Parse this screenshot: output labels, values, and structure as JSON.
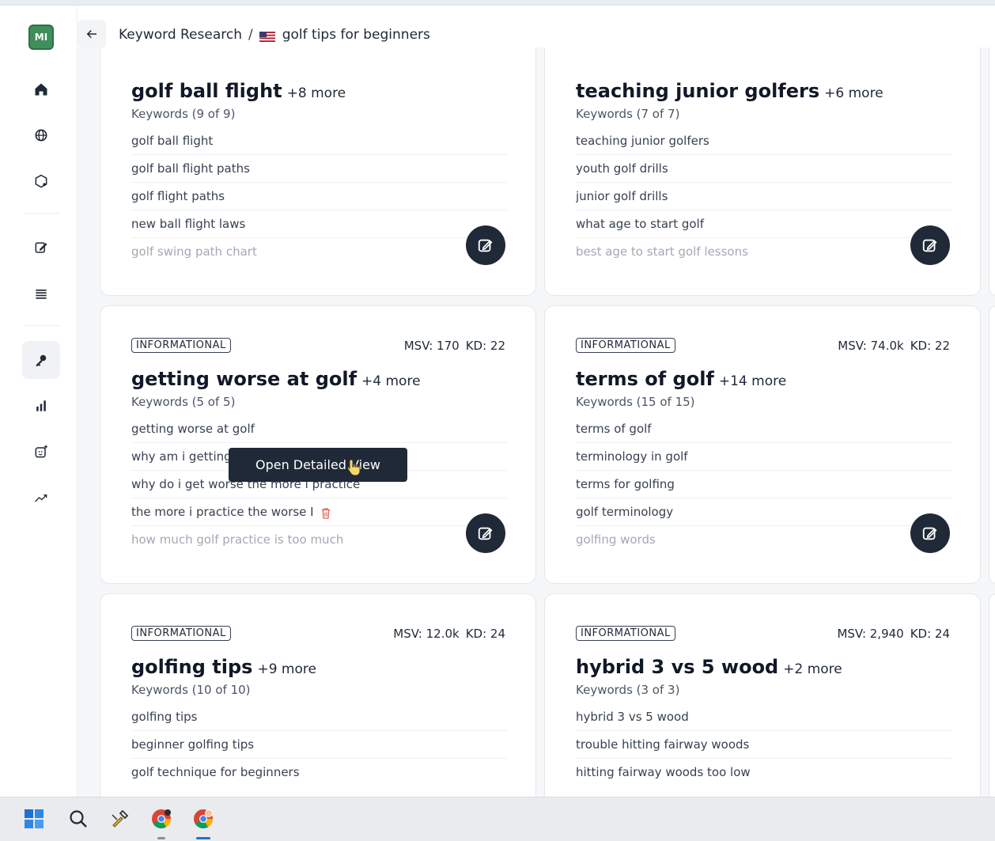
{
  "user": {
    "initials": "MI"
  },
  "header": {
    "breadcrumb_parent": "Keyword Research",
    "breadcrumb_separator": "/",
    "breadcrumb_current": "golf tips for beginners",
    "flag_icon": "us-flag-icon"
  },
  "sidebar": {
    "items": [
      {
        "icon": "home-icon"
      },
      {
        "icon": "globe-icon"
      },
      {
        "icon": "hexagon-settings-icon"
      },
      {
        "icon": "edit-document-icon"
      },
      {
        "icon": "list-icon"
      },
      {
        "icon": "key-icon",
        "active": true
      },
      {
        "icon": "bar-chart-icon"
      },
      {
        "icon": "ai-add-icon"
      },
      {
        "icon": "trend-up-icon"
      }
    ]
  },
  "cards": [
    {
      "title": "golf ball flight",
      "more": "+8 more",
      "kw_count": "Keywords (9 of 9)",
      "keywords": [
        "golf ball flight",
        "golf ball flight paths",
        "golf flight paths",
        "new ball flight laws",
        "golf swing path chart"
      ]
    },
    {
      "title": "teaching junior golfers",
      "more": "+6 more",
      "kw_count": "Keywords (7 of 7)",
      "keywords": [
        "teaching junior golfers",
        "youth golf drills",
        "junior golf drills",
        "what age to start golf",
        "best age to start golf lessons"
      ]
    },
    {
      "badge": "INFORMATIONAL",
      "msv_label": "MSV: 170",
      "kd_label": "KD: 22",
      "title": "getting worse at golf",
      "more": "+4 more",
      "kw_count": "Keywords (5 of 5)",
      "keywords": [
        "getting worse at golf",
        "why am i getting",
        "why do i get worse the more i practice",
        "the more i practice the worse I",
        "how much golf practice is too much"
      ]
    },
    {
      "badge": "INFORMATIONAL",
      "msv_label": "MSV: 74.0k",
      "kd_label": "KD: 22",
      "title": "terms of golf",
      "more": "+14 more",
      "kw_count": "Keywords (15 of 15)",
      "keywords": [
        "terms of golf",
        "terminology in golf",
        "terms for golfing",
        "golf terminology",
        "golfing words"
      ]
    },
    {
      "badge": "INFORMATIONAL",
      "msv_label": "MSV: 12.0k",
      "kd_label": "KD: 24",
      "title": "golfing tips",
      "more": "+9 more",
      "kw_count": "Keywords (10 of 10)",
      "keywords": [
        "golfing tips",
        "beginner golfing tips",
        "golf technique for beginners"
      ]
    },
    {
      "badge": "INFORMATIONAL",
      "msv_label": "MSV: 2,940",
      "kd_label": "KD: 24",
      "title": "hybrid 3 vs 5 wood",
      "more": "+2 more",
      "kw_count": "Keywords (3 of 3)",
      "keywords": [
        "hybrid 3 vs 5 wood",
        "trouble hitting fairway woods",
        "hitting fairway woods too low"
      ]
    }
  ],
  "tooltip": {
    "label": "Open Detailed View"
  },
  "taskbar": {
    "items": [
      "windows-start-icon",
      "search-icon",
      "tool-app-icon",
      "chrome-icon",
      "chrome-profile-icon"
    ]
  },
  "colors": {
    "accent_dark": "#1f2937",
    "avatar_green": "#3f8f5b",
    "trash_red": "#e0685a"
  }
}
